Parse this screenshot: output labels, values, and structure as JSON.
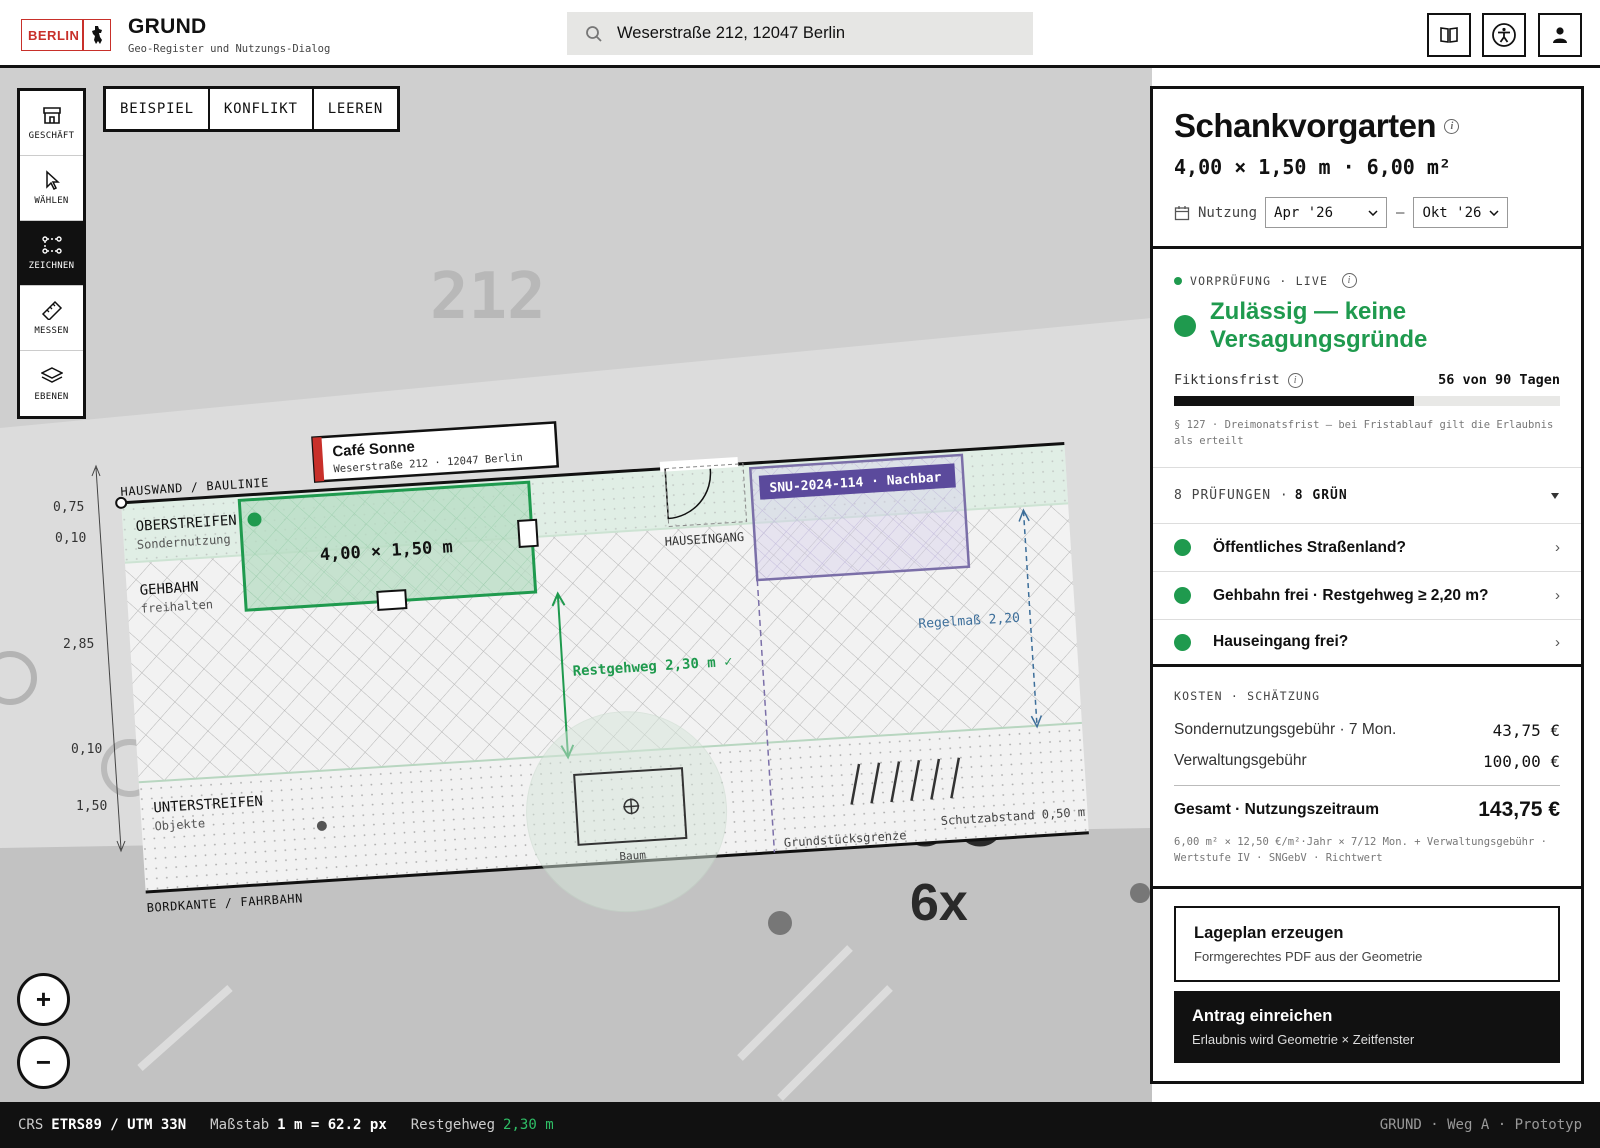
{
  "header": {
    "logo_text": "BERLIN",
    "title": "GRUND",
    "subtitle": "Geo-Register und Nutzungs-Dialog",
    "search_value": "Weserstraße 212, 12047 Berlin",
    "icons": [
      "book-icon",
      "accessibility-icon",
      "user-icon"
    ]
  },
  "tools": [
    {
      "label": "GESCHÄFT",
      "icon": "shop-icon"
    },
    {
      "label": "WÄHLEN",
      "icon": "cursor-icon"
    },
    {
      "label": "ZEICHNEN",
      "icon": "draw-icon",
      "active": true
    },
    {
      "label": "MESSEN",
      "icon": "ruler-icon"
    },
    {
      "label": "EBENEN",
      "icon": "layers-icon"
    }
  ],
  "scenarios": [
    "BEISPIEL",
    "KONFLIKT",
    "LEEREN"
  ],
  "map": {
    "house_number": "212",
    "shop_name": "Café Sonne",
    "shop_address": "Weserstraße 212 · 12047 Berlin",
    "label_wall": "HAUSWAND / BAULINIE",
    "label_curb": "BORDKANTE / FAHRBAHN",
    "label_upper": "OBERSTREIFEN",
    "label_upper_sub": "Sondernutzung",
    "label_walk": "GEHBAHN",
    "label_walk_sub": "freihalten",
    "label_lower": "UNTERSTREIFEN",
    "label_lower_sub": "Objekte",
    "area_dims": "4,00 × 1,50 m",
    "entrance": "HAUSEINGANG",
    "neighbor": "SNU-2024-114 · Nachbar",
    "rest_path": "Restgehweg 2,30 m ✓",
    "regular": "Regelmaß 2,20",
    "tree": "Baum",
    "lot_line": "Grundstücksgrenze",
    "safety": "Schutzabstand 0,50 m",
    "road_marking": "6x",
    "dims": [
      "0,75",
      "0,10",
      "2,85",
      "0,10",
      "1,50"
    ]
  },
  "panel": {
    "title": "Schankvorgarten",
    "dims": "4,00 × 1,50 m · 6,00 m²",
    "usage_label": "Nutzung",
    "from": "Apr '26",
    "dash": "–",
    "to": "Okt '26",
    "status_kicker": "VORPRÜFUNG · LIVE",
    "status_headline": "Zulässig — keine Versagungsgründe",
    "deadline_label": "Fiktionsfrist",
    "deadline_value": "56 von 90 Tagen",
    "deadline_progress": 0.622,
    "deadline_note": "§ 127 · Dreimonatsfrist — bei Fristablauf gilt die Erlaubnis als erteilt",
    "checks_summary_a": "8 PRÜFUNGEN · ",
    "checks_summary_b": "8 GRÜN",
    "checks": [
      "Öffentliches Straßenland?",
      "Gehbahn frei · Restgehweg ≥ 2,20 m?",
      "Hauseingang frei?"
    ],
    "cost_kicker": "KOSTEN · SCHÄTZUNG",
    "cost_rows": [
      {
        "label": "Sondernutzungsgebühr · 7 Mon.",
        "value": "43,75 €"
      },
      {
        "label": "Verwaltungsgebühr",
        "value": "100,00 €"
      }
    ],
    "total_label": "Gesamt · Nutzungszeitraum",
    "total_value": "143,75 €",
    "cost_note": "6,00 m² × 12,50 €/m²·Jahr × 7/12 Mon. + Verwaltungsgebühr · Wertstufe IV · SNGebV · Richtwert",
    "btn1_title": "Lageplan erzeugen",
    "btn1_sub": "Formgerechtes PDF aus der Geometrie",
    "btn2_title": "Antrag einreichen",
    "btn2_sub": "Erlaubnis wird Geometrie × Zeitfenster"
  },
  "footer": {
    "crs_label": "CRS",
    "crs_value": "ETRS89 / UTM 33N",
    "scale_label": "Maßstab",
    "scale_value": "1 m = 62.2 px",
    "rest_label": "Restgehweg",
    "rest_value": "2,30 m",
    "right": "GRUND · Weg A · Prototyp"
  },
  "colors": {
    "accent_green": "#1f9a4e",
    "berlin_red": "#c8302a",
    "neighbor_purple": "#5b4a9c"
  }
}
